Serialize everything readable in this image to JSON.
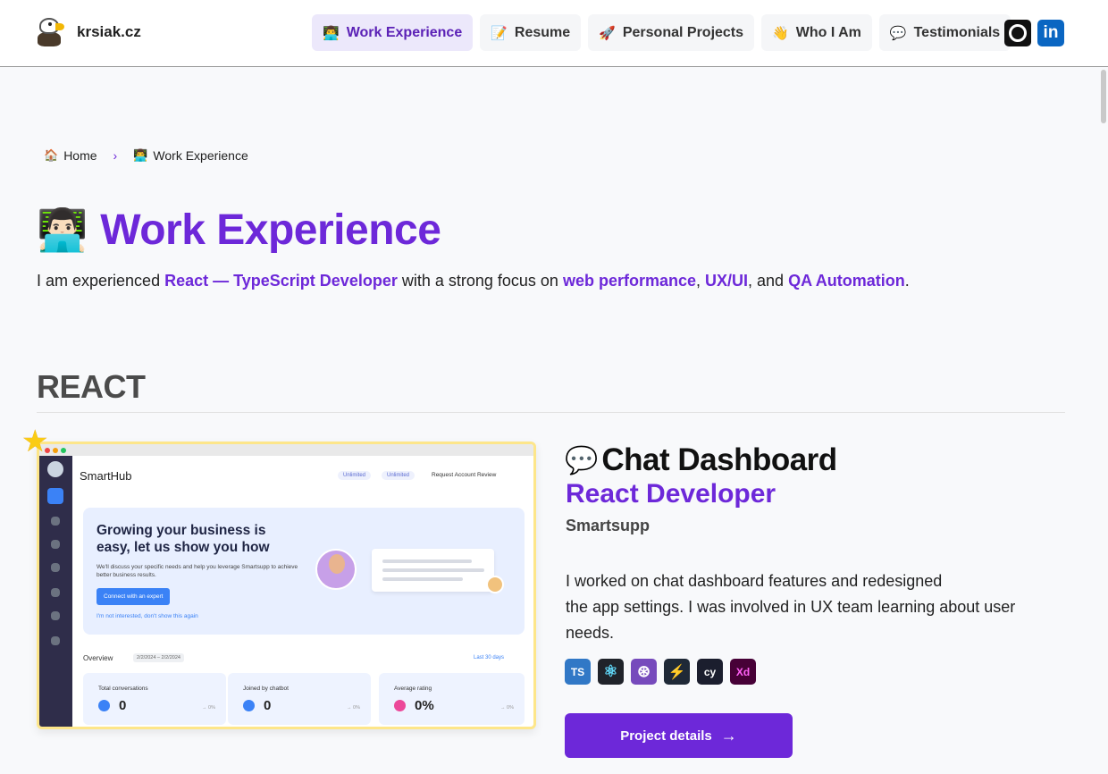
{
  "site": {
    "name": "krsiak.cz"
  },
  "nav": {
    "items": [
      {
        "icon": "👨‍💻",
        "label": "Work Experience",
        "active": true
      },
      {
        "icon": "📝",
        "label": "Resume"
      },
      {
        "icon": "🚀",
        "label": "Personal Projects"
      },
      {
        "icon": "👋",
        "label": "Who I Am"
      },
      {
        "icon": "💬",
        "label": "Testimonials"
      }
    ],
    "social": {
      "github_icon": "github-icon",
      "linkedin_label": "in"
    }
  },
  "breadcrumb": {
    "home_icon": "🏠",
    "home": "Home",
    "separator": "›",
    "current_icon": "👨‍💻",
    "current": "Work Experience"
  },
  "page": {
    "title_emoji": "👨🏻‍💻",
    "title": "Work Experience",
    "intro": {
      "t1": "I am experienced ",
      "h1": "React — TypeScript Developer",
      "t2": " with a strong focus on ",
      "h2": "web performance",
      "t3": ", ",
      "h3": "UX/UI",
      "t4": ", and ",
      "h4": "QA Automation",
      "t5": "."
    }
  },
  "section": {
    "title": "REACT"
  },
  "screenshot": {
    "app_title": "SmartHub",
    "pill1": "Unlimited",
    "pill2": "Unlimited",
    "request": "Request Account Review",
    "hero_heading_1": "Growing your business is",
    "hero_heading_2": "easy, let us show you how",
    "hero_text": "We'll discuss your specific needs and help you leverage Smartsupp to achieve better business results.",
    "hero_button": "Connect with an expert",
    "hero_link": "I'm not interested, don't show this again",
    "overview": "Overview",
    "overview_range": "2/2/2024 – 2/2/2024",
    "last_days": "Last 30 days",
    "stats": [
      {
        "label": "Total conversations",
        "value": "0",
        "pct": "→ 0%"
      },
      {
        "label": "Joined by chatbot",
        "value": "0",
        "pct": "→ 0%"
      },
      {
        "label": "Average rating",
        "value": "0%",
        "pct": "→ 0%"
      }
    ]
  },
  "project": {
    "icon": "💬",
    "name": "Chat Dashboard",
    "role": "React Developer",
    "company": "Smartsupp",
    "description_1": "I worked on chat dashboard features and redesigned",
    "description_2": "the app settings. I was involved in UX team learning about user needs.",
    "tech": [
      {
        "name": "typescript-icon",
        "label": "TS",
        "bg": "#3178c6",
        "fg": "#ffffff"
      },
      {
        "name": "react-icon",
        "label": "⚛",
        "bg": "#20232a",
        "fg": "#61dafb"
      },
      {
        "name": "redux-icon",
        "label": "⊛",
        "bg": "#764abc",
        "fg": "#ffffff"
      },
      {
        "name": "storybook-icon",
        "label": "⚡",
        "bg": "#1f2937",
        "fg": "#3dd6b4"
      },
      {
        "name": "cypress-icon",
        "label": "cy",
        "bg": "#1b1e2e",
        "fg": "#ffffff"
      },
      {
        "name": "adobe-xd-icon",
        "label": "Xd",
        "bg": "#470137",
        "fg": "#ff61f6"
      }
    ],
    "cta": "Project details",
    "cta_arrow": "→"
  }
}
